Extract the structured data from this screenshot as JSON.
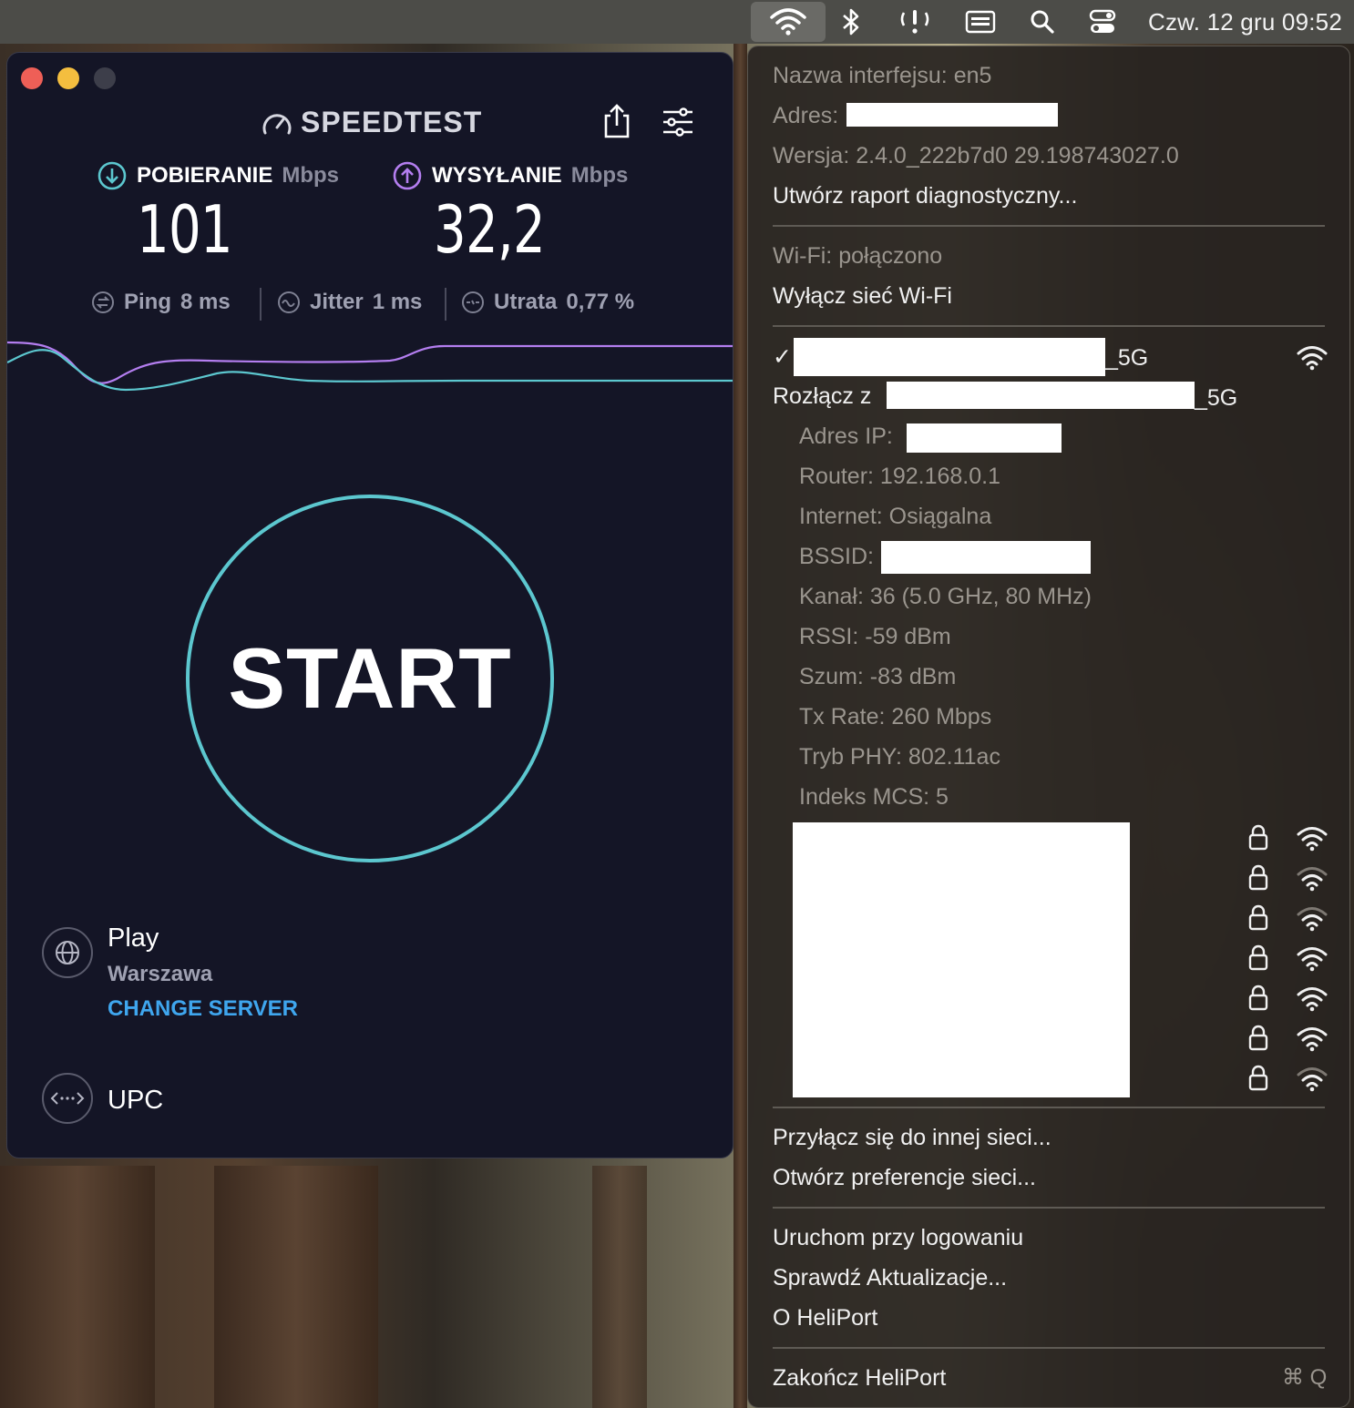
{
  "menubar": {
    "icons": [
      "wifi-icon",
      "bluetooth-icon",
      "antenna-alert-icon",
      "keyboard-icon",
      "search-icon",
      "control-center-icon"
    ],
    "clock": "Czw. 12 gru  09:52"
  },
  "speedtest": {
    "logo": "SPEEDTEST",
    "download": {
      "label": "POBIERANIE",
      "unit": "Mbps",
      "value": "101"
    },
    "upload": {
      "label": "WYSYŁANIE",
      "unit": "Mbps",
      "value": "32,2"
    },
    "ping": {
      "label": "Ping",
      "value": "8 ms"
    },
    "jitter": {
      "label": "Jitter",
      "value": "1 ms"
    },
    "loss": {
      "label": "Utrata",
      "value": "0,77 %"
    },
    "start_label": "START",
    "server": {
      "name": "Play",
      "city": "Warszawa",
      "change_label": "CHANGE SERVER"
    },
    "isp": "UPC",
    "colors": {
      "download": "#5cc7cf",
      "upload": "#b47ef0",
      "background": "#141526"
    }
  },
  "menu": {
    "interface": "Nazwa interfejsu: en5",
    "address_label": "Adres:",
    "version": "Wersja: 2.4.0_222b7d0 29.198743027.0",
    "diag": "Utwórz raport diagnostyczny...",
    "wifi_status": "Wi-Fi: połączono",
    "wifi_off": "Wyłącz sieć Wi-Fi",
    "current_network_suffix": "_5G",
    "checkmark": "✓",
    "disconnect_prefix": "Rozłącz z",
    "disconnect_suffix": "_5G",
    "details": {
      "ip_label": "Adres IP:",
      "router": "Router: 192.168.0.1",
      "internet": "Internet: Osiągalna",
      "bssid_label": "BSSID:",
      "channel": "Kanał: 36 (5.0 GHz, 80 MHz)",
      "rssi": "RSSI: -59 dBm",
      "noise": "Szum: -83 dBm",
      "tx_rate": "Tx Rate: 260 Mbps",
      "phy": "Tryb PHY: 802.11ac",
      "mcs": "Indeks MCS: 5"
    },
    "join_other": "Przyłącz się do innej sieci...",
    "open_prefs": "Otwórz preferencje sieci...",
    "launch_login": "Uruchom przy logowaniu",
    "check_updates": "Sprawdź Aktualizacje...",
    "about": "O HeliPort",
    "quit": "Zakończ HeliPort",
    "quit_shortcut": "⌘ Q"
  }
}
